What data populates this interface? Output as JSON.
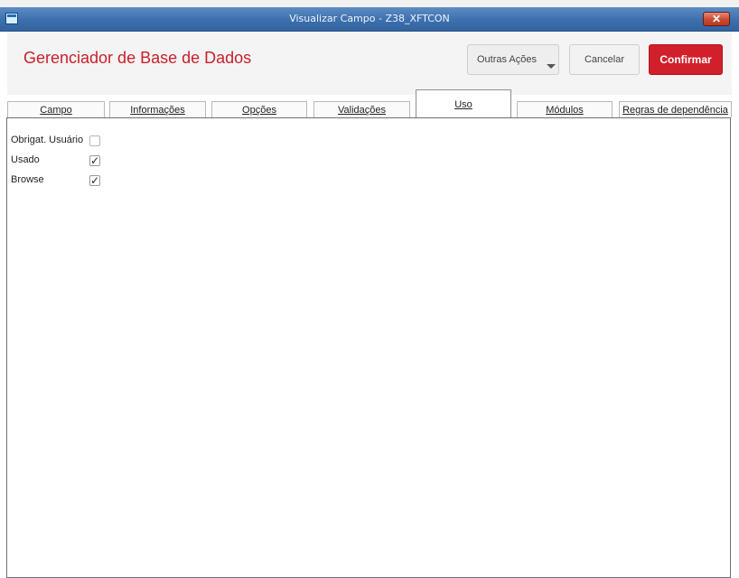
{
  "window": {
    "title": "Visualizar Campo - Z38_XFTCON",
    "close_glyph": "✕"
  },
  "header": {
    "title": "Gerenciador de Base de Dados",
    "buttons": {
      "outras": "Outras Ações",
      "cancelar": "Cancelar",
      "confirmar": "Confirmar"
    }
  },
  "tabs": [
    {
      "label": "Campo"
    },
    {
      "label": "Informações"
    },
    {
      "label": "Opções"
    },
    {
      "label": "Validações"
    },
    {
      "label": "Uso",
      "active": true
    },
    {
      "label": "Módulos"
    },
    {
      "label": "Regras de dependência"
    }
  ],
  "uso": {
    "fields": [
      {
        "label": "Obrigat. Usuário",
        "checked": false
      },
      {
        "label": "Usado",
        "checked": true
      },
      {
        "label": "Browse",
        "checked": true
      }
    ],
    "check_glyph": "✓"
  },
  "colors": {
    "accent": "#d1202b",
    "title_red": "#c8202a",
    "titlebar": "#3c6fae"
  },
  "icons": {
    "app": "window-app-icon",
    "close": "close-icon",
    "dropdown": "chevron-down-icon",
    "check": "checkmark-icon"
  }
}
